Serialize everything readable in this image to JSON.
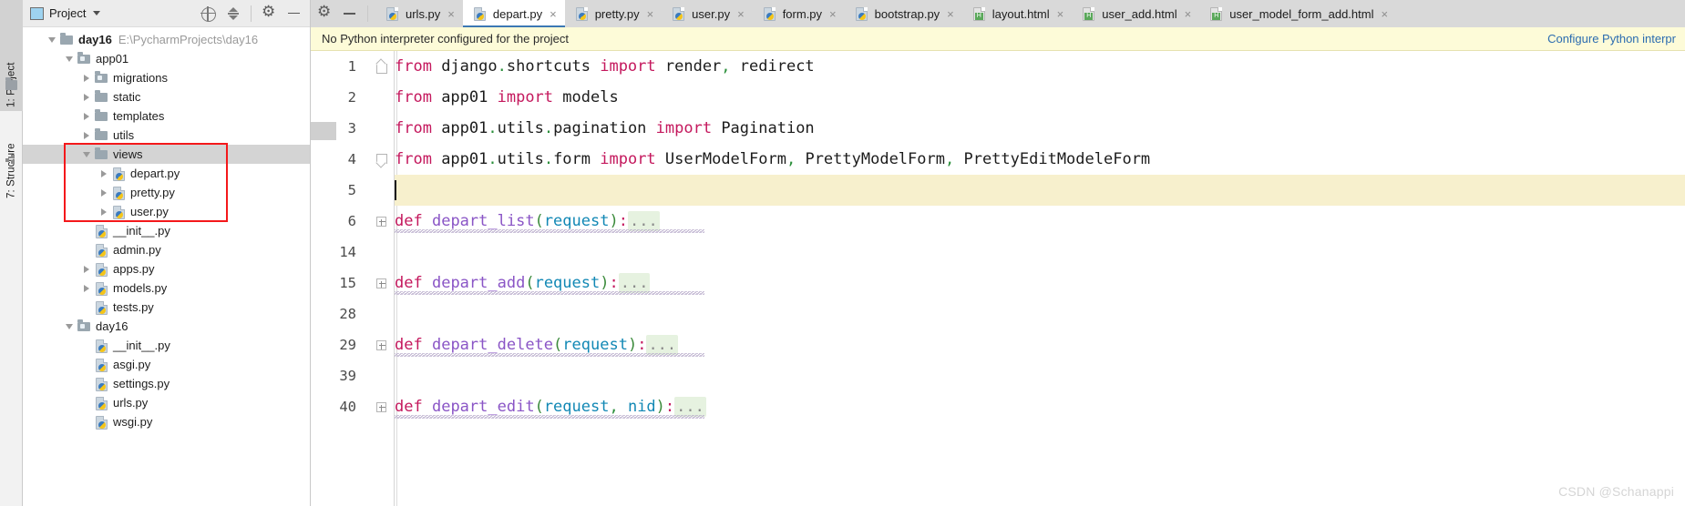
{
  "toolstrip": {
    "tabs": [
      {
        "label": "1: Project",
        "icon": "project-folder-icon",
        "active": true
      },
      {
        "label": "7: Structure",
        "icon": "structure-icon",
        "active": false
      }
    ]
  },
  "project_panel": {
    "title": "Project",
    "box_icon": "project-view-icon",
    "dropdown_icon": "chevron-down-icon",
    "actions": [
      {
        "name": "locate-in-tree-button",
        "icon": "target-icon",
        "tooltip": "Select Opened File"
      },
      {
        "name": "collapse-all-button",
        "icon": "collapse-all-icon",
        "tooltip": "Collapse All"
      },
      {
        "name": "settings-button",
        "icon": "gear-icon",
        "tooltip": "Settings"
      },
      {
        "name": "hide-button",
        "icon": "minus-icon",
        "tooltip": "Hide"
      }
    ],
    "tree": [
      {
        "label": "day16",
        "path": "E:\\PycharmProjects\\day16",
        "icon": "folder-icon",
        "indent": 0,
        "twisty": "open",
        "bold": true,
        "selected": false
      },
      {
        "label": "app01",
        "path": "",
        "icon": "module-folder-icon",
        "indent": 1,
        "twisty": "open",
        "bold": false,
        "selected": false
      },
      {
        "label": "migrations",
        "path": "",
        "icon": "module-folder-icon",
        "indent": 2,
        "twisty": "closed",
        "bold": false,
        "selected": false
      },
      {
        "label": "static",
        "path": "",
        "icon": "folder-icon",
        "indent": 2,
        "twisty": "closed",
        "bold": false,
        "selected": false
      },
      {
        "label": "templates",
        "path": "",
        "icon": "folder-icon",
        "indent": 2,
        "twisty": "closed",
        "bold": false,
        "selected": false
      },
      {
        "label": "utils",
        "path": "",
        "icon": "folder-icon",
        "indent": 2,
        "twisty": "closed",
        "bold": false,
        "selected": false
      },
      {
        "label": "views",
        "path": "",
        "icon": "folder-icon",
        "indent": 2,
        "twisty": "open",
        "bold": false,
        "selected": true
      },
      {
        "label": "depart.py",
        "path": "",
        "icon": "python-file-icon",
        "indent": 3,
        "twisty": "closed",
        "bold": false,
        "selected": false
      },
      {
        "label": "pretty.py",
        "path": "",
        "icon": "python-file-icon",
        "indent": 3,
        "twisty": "closed",
        "bold": false,
        "selected": false
      },
      {
        "label": "user.py",
        "path": "",
        "icon": "python-file-icon",
        "indent": 3,
        "twisty": "closed",
        "bold": false,
        "selected": false
      },
      {
        "label": "__init__.py",
        "path": "",
        "icon": "python-file-icon",
        "indent": 2,
        "twisty": "none",
        "bold": false,
        "selected": false
      },
      {
        "label": "admin.py",
        "path": "",
        "icon": "python-file-icon",
        "indent": 2,
        "twisty": "none",
        "bold": false,
        "selected": false
      },
      {
        "label": "apps.py",
        "path": "",
        "icon": "python-file-icon",
        "indent": 2,
        "twisty": "closed",
        "bold": false,
        "selected": false
      },
      {
        "label": "models.py",
        "path": "",
        "icon": "python-file-icon",
        "indent": 2,
        "twisty": "closed",
        "bold": false,
        "selected": false
      },
      {
        "label": "tests.py",
        "path": "",
        "icon": "python-file-icon",
        "indent": 2,
        "twisty": "none",
        "bold": false,
        "selected": false
      },
      {
        "label": "day16",
        "path": "",
        "icon": "module-folder-icon",
        "indent": 1,
        "twisty": "open",
        "bold": false,
        "selected": false
      },
      {
        "label": "__init__.py",
        "path": "",
        "icon": "python-file-icon",
        "indent": 2,
        "twisty": "none",
        "bold": false,
        "selected": false
      },
      {
        "label": "asgi.py",
        "path": "",
        "icon": "python-file-icon",
        "indent": 2,
        "twisty": "none",
        "bold": false,
        "selected": false
      },
      {
        "label": "settings.py",
        "path": "",
        "icon": "python-file-icon",
        "indent": 2,
        "twisty": "none",
        "bold": false,
        "selected": false
      },
      {
        "label": "urls.py",
        "path": "",
        "icon": "python-file-icon",
        "indent": 2,
        "twisty": "none",
        "bold": false,
        "selected": false
      },
      {
        "label": "wsgi.py",
        "path": "",
        "icon": "python-file-icon",
        "indent": 2,
        "twisty": "none",
        "bold": false,
        "selected": false
      }
    ],
    "annotation": {
      "color": "#f4181b",
      "shape": "rectangle",
      "target": "views-folder-children"
    }
  },
  "editor": {
    "tabs": [
      {
        "label": "urls.py",
        "icon": "python-file-icon",
        "active": false,
        "close": "×"
      },
      {
        "label": "depart.py",
        "icon": "python-file-icon",
        "active": true,
        "close": "×"
      },
      {
        "label": "pretty.py",
        "icon": "python-file-icon",
        "active": false,
        "close": "×"
      },
      {
        "label": "user.py",
        "icon": "python-file-icon",
        "active": false,
        "close": "×"
      },
      {
        "label": "form.py",
        "icon": "python-file-icon",
        "active": false,
        "close": "×"
      },
      {
        "label": "bootstrap.py",
        "icon": "python-file-icon",
        "active": false,
        "close": "×"
      },
      {
        "label": "layout.html",
        "icon": "html-file-icon",
        "active": false,
        "close": "×"
      },
      {
        "label": "user_add.html",
        "icon": "html-file-icon",
        "active": false,
        "close": "×"
      },
      {
        "label": "user_model_form_add.html",
        "icon": "html-file-icon",
        "active": false,
        "close": "×"
      }
    ],
    "notification": {
      "message": "No Python interpreter configured for the project",
      "link": "Configure Python interpr",
      "bg": "#fdfbd8",
      "link_color": "#2b6cb0"
    },
    "code": {
      "language": "python",
      "lines": [
        {
          "num": "1",
          "fold": "top",
          "current": false,
          "squiggle": false,
          "tokens": [
            {
              "t": "from",
              "c": "kw"
            },
            {
              "t": " django",
              "c": "plain"
            },
            {
              "t": ".",
              "c": "dot"
            },
            {
              "t": "shortcuts ",
              "c": "plain"
            },
            {
              "t": "import",
              "c": "kw"
            },
            {
              "t": " render",
              "c": "plain"
            },
            {
              "t": ",",
              "c": "dot"
            },
            {
              "t": " redirect",
              "c": "plain"
            }
          ]
        },
        {
          "num": "2",
          "fold": "none",
          "current": false,
          "squiggle": false,
          "tokens": [
            {
              "t": "from",
              "c": "kw"
            },
            {
              "t": " app01 ",
              "c": "plain"
            },
            {
              "t": "import",
              "c": "kw"
            },
            {
              "t": " models",
              "c": "plain"
            }
          ]
        },
        {
          "num": "3",
          "fold": "none",
          "current": false,
          "squiggle": false,
          "tokens": [
            {
              "t": "from",
              "c": "kw"
            },
            {
              "t": " app01",
              "c": "plain"
            },
            {
              "t": ".",
              "c": "dot"
            },
            {
              "t": "utils",
              "c": "plain"
            },
            {
              "t": ".",
              "c": "dot"
            },
            {
              "t": "pagination ",
              "c": "plain"
            },
            {
              "t": "import",
              "c": "kw"
            },
            {
              "t": " Pagination",
              "c": "plain"
            }
          ]
        },
        {
          "num": "4",
          "fold": "bottom",
          "current": false,
          "squiggle": false,
          "tokens": [
            {
              "t": "from",
              "c": "kw"
            },
            {
              "t": " app01",
              "c": "plain"
            },
            {
              "t": ".",
              "c": "dot"
            },
            {
              "t": "utils",
              "c": "plain"
            },
            {
              "t": ".",
              "c": "dot"
            },
            {
              "t": "form ",
              "c": "plain"
            },
            {
              "t": "import",
              "c": "kw"
            },
            {
              "t": " UserModelForm",
              "c": "plain"
            },
            {
              "t": ",",
              "c": "dot"
            },
            {
              "t": " PrettyModelForm",
              "c": "plain"
            },
            {
              "t": ",",
              "c": "dot"
            },
            {
              "t": " PrettyEditModeleForm",
              "c": "plain"
            }
          ]
        },
        {
          "num": "5",
          "fold": "none",
          "current": true,
          "squiggle": false,
          "tokens": []
        },
        {
          "num": "6",
          "fold": "plus",
          "current": false,
          "squiggle": true,
          "tokens": [
            {
              "t": "def",
              "c": "kw"
            },
            {
              "t": " ",
              "c": "plain"
            },
            {
              "t": "depart_list",
              "c": "fn"
            },
            {
              "t": "(",
              "c": "paren"
            },
            {
              "t": "request",
              "c": "arg"
            },
            {
              "t": ")",
              "c": "paren"
            },
            {
              "t": ":",
              "c": "colon"
            },
            {
              "t": "...",
              "c": "ellip"
            }
          ]
        },
        {
          "num": "14",
          "fold": "none",
          "current": false,
          "squiggle": false,
          "tokens": []
        },
        {
          "num": "15",
          "fold": "plus",
          "current": false,
          "squiggle": true,
          "tokens": [
            {
              "t": "def",
              "c": "kw"
            },
            {
              "t": " ",
              "c": "plain"
            },
            {
              "t": "depart_add",
              "c": "fn"
            },
            {
              "t": "(",
              "c": "paren"
            },
            {
              "t": "request",
              "c": "arg"
            },
            {
              "t": ")",
              "c": "paren"
            },
            {
              "t": ":",
              "c": "colon"
            },
            {
              "t": "...",
              "c": "ellip"
            }
          ]
        },
        {
          "num": "28",
          "fold": "none",
          "current": false,
          "squiggle": false,
          "tokens": []
        },
        {
          "num": "29",
          "fold": "plus",
          "current": false,
          "squiggle": true,
          "tokens": [
            {
              "t": "def",
              "c": "kw"
            },
            {
              "t": " ",
              "c": "plain"
            },
            {
              "t": "depart_delete",
              "c": "fn"
            },
            {
              "t": "(",
              "c": "paren"
            },
            {
              "t": "request",
              "c": "arg"
            },
            {
              "t": ")",
              "c": "paren"
            },
            {
              "t": ":",
              "c": "colon"
            },
            {
              "t": "...",
              "c": "ellip"
            }
          ]
        },
        {
          "num": "39",
          "fold": "none",
          "current": false,
          "squiggle": false,
          "tokens": []
        },
        {
          "num": "40",
          "fold": "plus",
          "current": false,
          "squiggle": true,
          "tokens": [
            {
              "t": "def",
              "c": "kw"
            },
            {
              "t": " ",
              "c": "plain"
            },
            {
              "t": "depart_edit",
              "c": "fn"
            },
            {
              "t": "(",
              "c": "paren"
            },
            {
              "t": "request",
              "c": "arg"
            },
            {
              "t": ",",
              "c": "dot"
            },
            {
              "t": " nid",
              "c": "arg"
            },
            {
              "t": ")",
              "c": "paren"
            },
            {
              "t": ":",
              "c": "colon"
            },
            {
              "t": "...",
              "c": "ellip"
            }
          ]
        }
      ]
    }
  },
  "watermark": "CSDN @Schanappi",
  "colors": {
    "accent": "#3c78b4",
    "keyword": "#c4185d",
    "function": "#8a55c6",
    "argument": "#1288b5",
    "annotation_red": "#f4181b",
    "current_line": "#f7f0cd",
    "notification_bg": "#fdfbd8"
  }
}
